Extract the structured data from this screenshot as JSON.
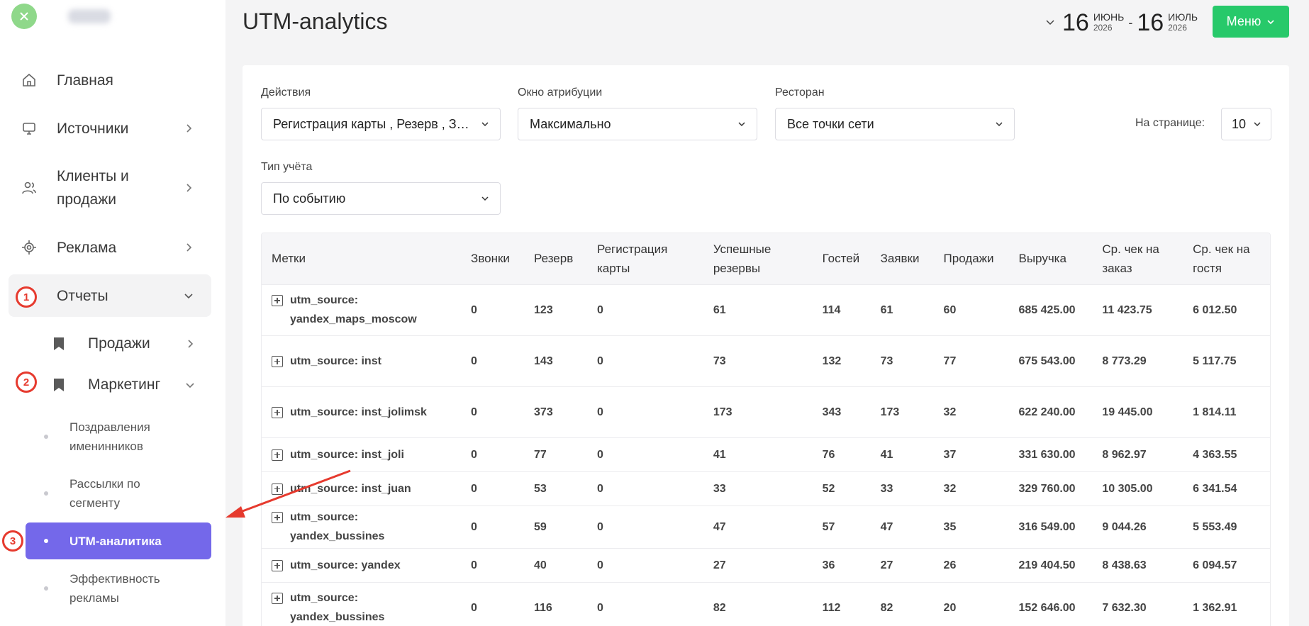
{
  "sidebar": {
    "nav": [
      {
        "label": "Главная",
        "icon": "home-icon"
      },
      {
        "label": "Источники",
        "icon": "monitor-icon"
      },
      {
        "label": "Клиенты и продажи",
        "icon": "users-icon"
      },
      {
        "label": "Реклама",
        "icon": "target-icon"
      },
      {
        "label": "Отчеты",
        "icon": "reports-icon"
      }
    ],
    "sub": [
      {
        "label": "Продажи",
        "icon": "bookmark-icon"
      },
      {
        "label": "Маркетинг",
        "icon": "bookmark-icon"
      }
    ],
    "leaves": [
      {
        "label": "Поздравления именинников"
      },
      {
        "label": "Рассылки по сегменту"
      },
      {
        "label": "UTM-аналитика"
      },
      {
        "label": "Эффективность рекламы"
      }
    ],
    "badges": [
      "1",
      "2",
      "3"
    ],
    "active_color": "#7468ea"
  },
  "header": {
    "title": "UTM-analytics",
    "date_from": {
      "day": "16",
      "month": "ИЮНЬ",
      "year": "2026"
    },
    "date_sep": "-",
    "date_to": {
      "day": "16",
      "month": "ИЮЛЬ",
      "year": "2026"
    },
    "menu_label": "Меню",
    "menu_color": "#27c96a"
  },
  "filters": {
    "actions": {
      "label": "Действия",
      "value": "Регистрация карты , Резерв , Звонки"
    },
    "window": {
      "label": "Окно атрибуции",
      "value": "Максимально"
    },
    "restaurant": {
      "label": "Ресторан",
      "value": "Все точки сети"
    },
    "per_page": {
      "label": "На странице:",
      "value": "10"
    },
    "accounting": {
      "label": "Тип учёта",
      "value": "По событию"
    }
  },
  "table": {
    "columns": [
      "Метки",
      "Звонки",
      "Резерв",
      "Регистрация карты",
      "Успешные резервы",
      "Гостей",
      "Заявки",
      "Продажи",
      "Выручка",
      "Ср. чек на заказ",
      "Ср. чек на гостя"
    ],
    "rows": [
      [
        "utm_source: yandex_maps_moscow",
        "0",
        "123",
        "0",
        "61",
        "114",
        "61",
        "60",
        "685 425.00",
        "11 423.75",
        "6 012.50"
      ],
      [
        "utm_source: inst",
        "0",
        "143",
        "0",
        "73",
        "132",
        "73",
        "77",
        "675 543.00",
        "8 773.29",
        "5 117.75"
      ],
      [
        "utm_source: inst_jolimsk",
        "0",
        "373",
        "0",
        "173",
        "343",
        "173",
        "32",
        "622 240.00",
        "19 445.00",
        "1 814.11"
      ],
      [
        "utm_source: inst_joli",
        "0",
        "77",
        "0",
        "41",
        "76",
        "41",
        "37",
        "331 630.00",
        "8 962.97",
        "4 363.55"
      ],
      [
        "utm_source: inst_juan",
        "0",
        "53",
        "0",
        "33",
        "52",
        "33",
        "32",
        "329 760.00",
        "10 305.00",
        "6 341.54"
      ],
      [
        "utm_source: yandex_bussines",
        "0",
        "59",
        "0",
        "47",
        "57",
        "47",
        "35",
        "316 549.00",
        "9 044.26",
        "5 553.49"
      ],
      [
        "utm_source: yandex",
        "0",
        "40",
        "0",
        "27",
        "36",
        "27",
        "26",
        "219 404.50",
        "8 438.63",
        "6 094.57"
      ],
      [
        "utm_source: yandex_bussines",
        "0",
        "116",
        "0",
        "82",
        "112",
        "82",
        "20",
        "152 646.00",
        "7 632.30",
        "1 362.91"
      ]
    ]
  }
}
